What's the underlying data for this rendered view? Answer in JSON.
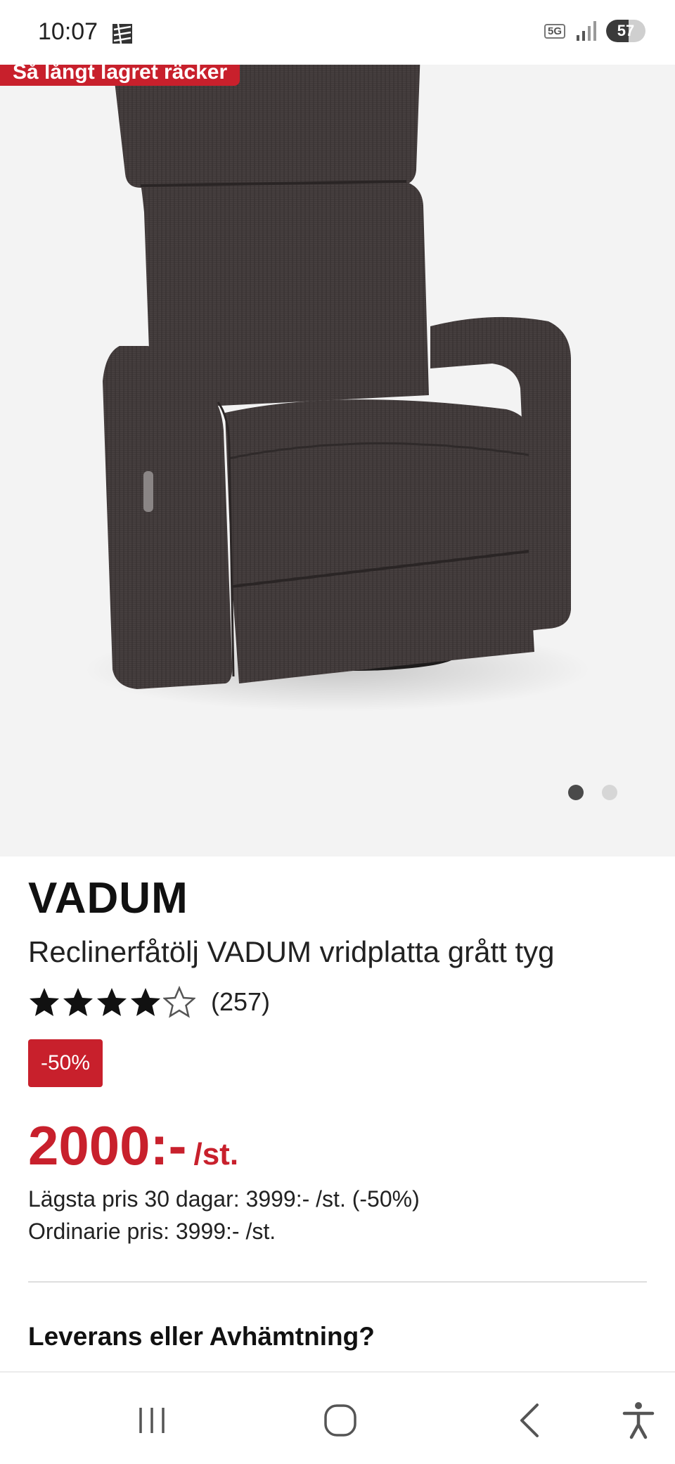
{
  "status_bar": {
    "time": "10:07",
    "network": "5G",
    "battery": "57",
    "battery_level": 0.57
  },
  "hero": {
    "promo_banner": "Så långt lagret räcker",
    "slides_count": 2,
    "active_slide": 1
  },
  "product": {
    "brand": "VADUM",
    "name": "Reclinerfåtölj VADUM vridplatta grått tyg",
    "rating": 4,
    "rating_max": 5,
    "review_count": "(257)",
    "discount_badge": "-50%",
    "price": "2000:-",
    "price_unit": "/st.",
    "lowest_price_30_days": "Lägsta pris 30 dagar: 3999:- /st. (-50%)",
    "ordinary_price": "Ordinarie pris: 3999:- /st."
  },
  "delivery": {
    "heading": "Leverans eller Avhämtning?"
  },
  "colors": {
    "accent_red": "#c8202c",
    "chair_fabric": "#3f3838"
  },
  "nav": {
    "items": [
      "recent-apps-icon",
      "home-icon",
      "back-icon",
      "accessibility-icon"
    ]
  }
}
